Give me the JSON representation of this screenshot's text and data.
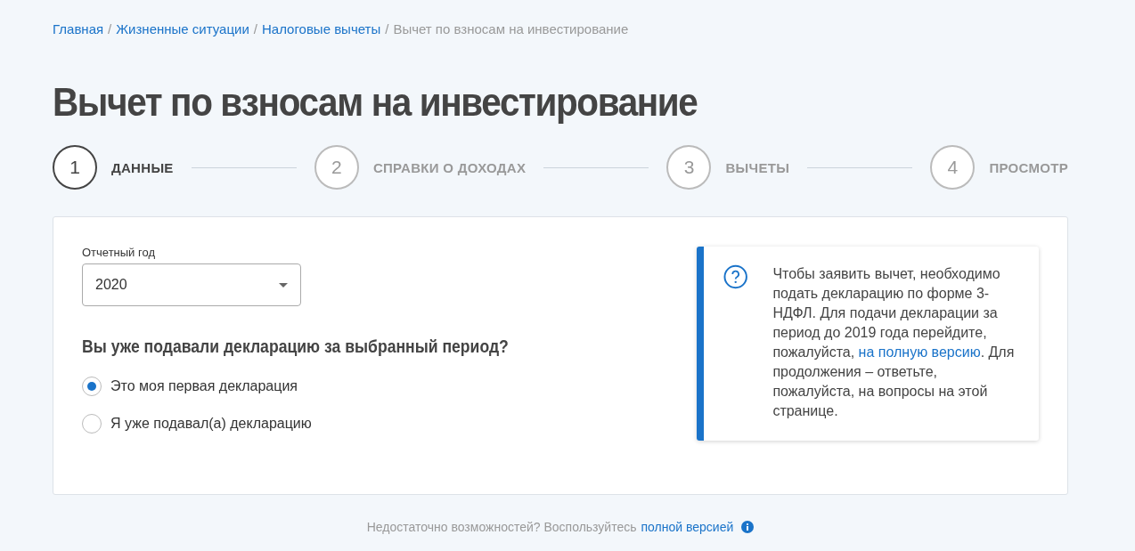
{
  "breadcrumb_separator": "/",
  "breadcrumbs": [
    {
      "label": "Главная",
      "current": false
    },
    {
      "label": "Жизненные ситуации",
      "current": false
    },
    {
      "label": "Налоговые вычеты",
      "current": false
    },
    {
      "label": "Вычет по взносам на инвестирование",
      "current": true
    }
  ],
  "title": "Вычет по взносам на инвестирование",
  "steps": [
    {
      "number": "1",
      "label": "ДАННЫЕ",
      "selected": true
    },
    {
      "number": "2",
      "label": "СПРАВКИ О ДОХОДАХ",
      "selected": false
    },
    {
      "number": "3",
      "label": "ВЫЧЕТЫ",
      "selected": false
    },
    {
      "number": "4",
      "label": "ПРОСМОТР",
      "selected": false
    }
  ],
  "form": {
    "year_label": "Отчетный год",
    "year_value": "2020",
    "question": "Вы уже подавали декларацию за выбранный период?",
    "options": [
      {
        "label": "Это моя первая декларация",
        "selected": true
      },
      {
        "label": "Я уже подавал(а) декларацию",
        "selected": false
      }
    ]
  },
  "info": {
    "text_before": "Чтобы заявить вычет, необходимо подать декларацию по форме 3-НДФЛ. Для подачи декларации за период до 2019 года перейдите, пожалуйста, ",
    "link": "на полную версию",
    "text_after": ". Для продолжения – ответьте, пожалуйста, на вопросы на этой странице."
  },
  "footer": {
    "text": "Недостаточно возможностей? Воспользуйтесь",
    "link": "полной версией"
  }
}
